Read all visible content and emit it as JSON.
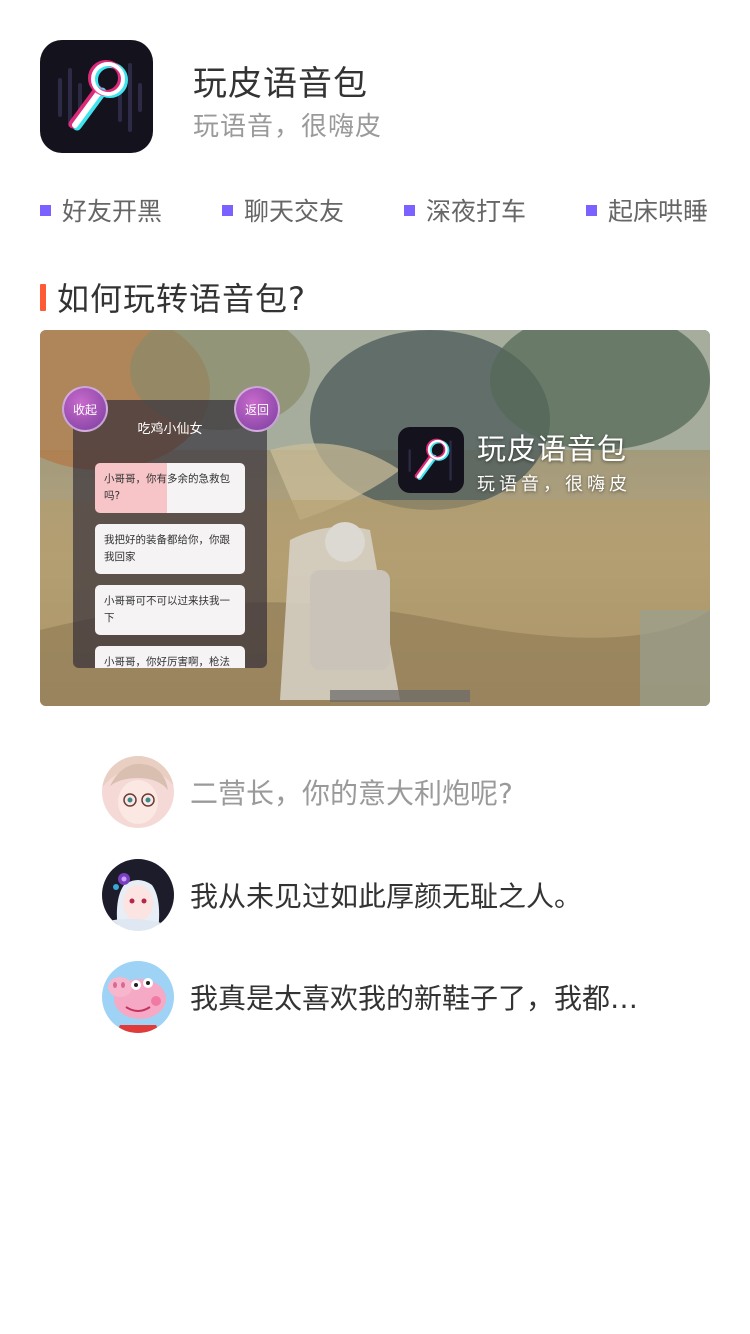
{
  "app": {
    "name": "玩皮语音包",
    "slogan": "玩语音，很嗨皮",
    "icon": "microphone-logo-icon"
  },
  "tags": [
    {
      "label": "好友开黑"
    },
    {
      "label": "聊天交友"
    },
    {
      "label": "深夜打车"
    },
    {
      "label": "起床哄睡"
    }
  ],
  "section": {
    "title": "如何玩转语音包?"
  },
  "hero": {
    "panel_title": "吃鸡小仙女",
    "collapse_label": "收起",
    "back_label": "返回",
    "messages": [
      {
        "text": "小哥哥，你有多余的急救包吗?"
      },
      {
        "text": "我把好的装备都给你，你跟我回家"
      },
      {
        "text": "小哥哥可不可以过来扶我一下"
      },
      {
        "text": "小哥哥，你好厉害啊，枪法"
      }
    ],
    "brand_name": "玩皮语音包",
    "brand_slogan": "玩语音，很嗨皮"
  },
  "voices": [
    {
      "text": "二营长，你的意大利炮呢?",
      "avatar": "anime-girl-glasses-avatar"
    },
    {
      "text": "我从未见过如此厚颜无耻之人。",
      "avatar": "anime-girl-dark-hair-avatar"
    },
    {
      "text": "我真是太喜欢我的新鞋子了，我都…",
      "avatar": "peppa-pig-avatar"
    }
  ],
  "colors": {
    "accent": "#7b61ff",
    "section_bar": "#ff5a36",
    "text_primary": "#333333",
    "text_secondary": "#9a9a9a"
  }
}
